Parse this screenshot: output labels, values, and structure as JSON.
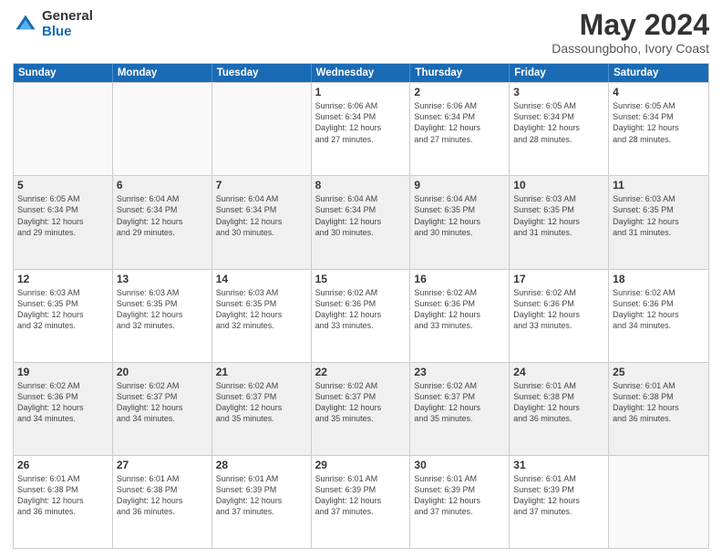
{
  "header": {
    "logo_general": "General",
    "logo_blue": "Blue",
    "month_year": "May 2024",
    "location": "Dassoungboho, Ivory Coast"
  },
  "calendar": {
    "days_of_week": [
      "Sunday",
      "Monday",
      "Tuesday",
      "Wednesday",
      "Thursday",
      "Friday",
      "Saturday"
    ],
    "rows": [
      [
        {
          "day": "",
          "info": "",
          "empty": true
        },
        {
          "day": "",
          "info": "",
          "empty": true
        },
        {
          "day": "",
          "info": "",
          "empty": true
        },
        {
          "day": "1",
          "info": "Sunrise: 6:06 AM\nSunset: 6:34 PM\nDaylight: 12 hours\nand 27 minutes."
        },
        {
          "day": "2",
          "info": "Sunrise: 6:06 AM\nSunset: 6:34 PM\nDaylight: 12 hours\nand 27 minutes."
        },
        {
          "day": "3",
          "info": "Sunrise: 6:05 AM\nSunset: 6:34 PM\nDaylight: 12 hours\nand 28 minutes."
        },
        {
          "day": "4",
          "info": "Sunrise: 6:05 AM\nSunset: 6:34 PM\nDaylight: 12 hours\nand 28 minutes."
        }
      ],
      [
        {
          "day": "5",
          "info": "Sunrise: 6:05 AM\nSunset: 6:34 PM\nDaylight: 12 hours\nand 29 minutes."
        },
        {
          "day": "6",
          "info": "Sunrise: 6:04 AM\nSunset: 6:34 PM\nDaylight: 12 hours\nand 29 minutes."
        },
        {
          "day": "7",
          "info": "Sunrise: 6:04 AM\nSunset: 6:34 PM\nDaylight: 12 hours\nand 30 minutes."
        },
        {
          "day": "8",
          "info": "Sunrise: 6:04 AM\nSunset: 6:34 PM\nDaylight: 12 hours\nand 30 minutes."
        },
        {
          "day": "9",
          "info": "Sunrise: 6:04 AM\nSunset: 6:35 PM\nDaylight: 12 hours\nand 30 minutes."
        },
        {
          "day": "10",
          "info": "Sunrise: 6:03 AM\nSunset: 6:35 PM\nDaylight: 12 hours\nand 31 minutes."
        },
        {
          "day": "11",
          "info": "Sunrise: 6:03 AM\nSunset: 6:35 PM\nDaylight: 12 hours\nand 31 minutes."
        }
      ],
      [
        {
          "day": "12",
          "info": "Sunrise: 6:03 AM\nSunset: 6:35 PM\nDaylight: 12 hours\nand 32 minutes."
        },
        {
          "day": "13",
          "info": "Sunrise: 6:03 AM\nSunset: 6:35 PM\nDaylight: 12 hours\nand 32 minutes."
        },
        {
          "day": "14",
          "info": "Sunrise: 6:03 AM\nSunset: 6:35 PM\nDaylight: 12 hours\nand 32 minutes."
        },
        {
          "day": "15",
          "info": "Sunrise: 6:02 AM\nSunset: 6:36 PM\nDaylight: 12 hours\nand 33 minutes."
        },
        {
          "day": "16",
          "info": "Sunrise: 6:02 AM\nSunset: 6:36 PM\nDaylight: 12 hours\nand 33 minutes."
        },
        {
          "day": "17",
          "info": "Sunrise: 6:02 AM\nSunset: 6:36 PM\nDaylight: 12 hours\nand 33 minutes."
        },
        {
          "day": "18",
          "info": "Sunrise: 6:02 AM\nSunset: 6:36 PM\nDaylight: 12 hours\nand 34 minutes."
        }
      ],
      [
        {
          "day": "19",
          "info": "Sunrise: 6:02 AM\nSunset: 6:36 PM\nDaylight: 12 hours\nand 34 minutes."
        },
        {
          "day": "20",
          "info": "Sunrise: 6:02 AM\nSunset: 6:37 PM\nDaylight: 12 hours\nand 34 minutes."
        },
        {
          "day": "21",
          "info": "Sunrise: 6:02 AM\nSunset: 6:37 PM\nDaylight: 12 hours\nand 35 minutes."
        },
        {
          "day": "22",
          "info": "Sunrise: 6:02 AM\nSunset: 6:37 PM\nDaylight: 12 hours\nand 35 minutes."
        },
        {
          "day": "23",
          "info": "Sunrise: 6:02 AM\nSunset: 6:37 PM\nDaylight: 12 hours\nand 35 minutes."
        },
        {
          "day": "24",
          "info": "Sunrise: 6:01 AM\nSunset: 6:38 PM\nDaylight: 12 hours\nand 36 minutes."
        },
        {
          "day": "25",
          "info": "Sunrise: 6:01 AM\nSunset: 6:38 PM\nDaylight: 12 hours\nand 36 minutes."
        }
      ],
      [
        {
          "day": "26",
          "info": "Sunrise: 6:01 AM\nSunset: 6:38 PM\nDaylight: 12 hours\nand 36 minutes."
        },
        {
          "day": "27",
          "info": "Sunrise: 6:01 AM\nSunset: 6:38 PM\nDaylight: 12 hours\nand 36 minutes."
        },
        {
          "day": "28",
          "info": "Sunrise: 6:01 AM\nSunset: 6:39 PM\nDaylight: 12 hours\nand 37 minutes."
        },
        {
          "day": "29",
          "info": "Sunrise: 6:01 AM\nSunset: 6:39 PM\nDaylight: 12 hours\nand 37 minutes."
        },
        {
          "day": "30",
          "info": "Sunrise: 6:01 AM\nSunset: 6:39 PM\nDaylight: 12 hours\nand 37 minutes."
        },
        {
          "day": "31",
          "info": "Sunrise: 6:01 AM\nSunset: 6:39 PM\nDaylight: 12 hours\nand 37 minutes."
        },
        {
          "day": "",
          "info": "",
          "empty": true
        }
      ]
    ]
  }
}
